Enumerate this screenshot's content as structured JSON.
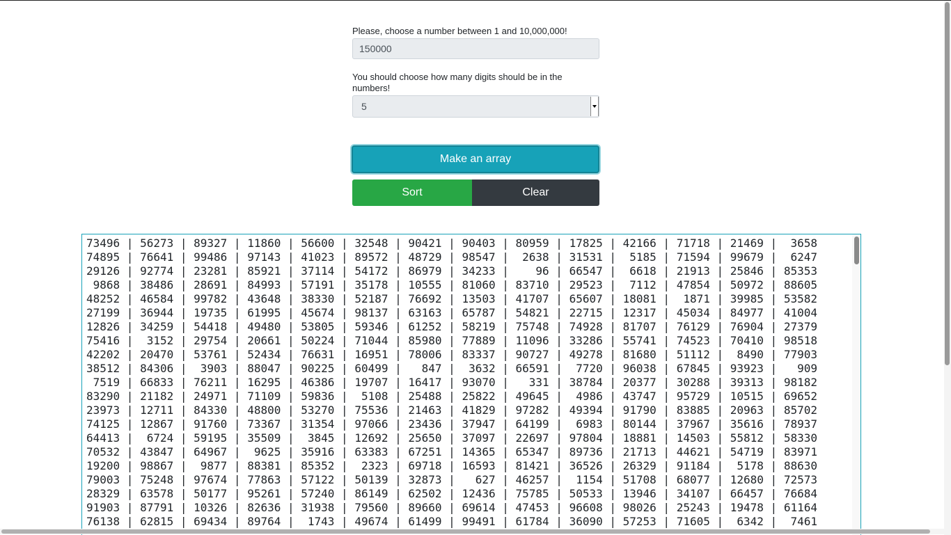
{
  "form": {
    "number_label": "Please, choose a number between 1 and 10,000,000!",
    "number_value": "150000",
    "digits_label": "You should choose how many digits should be in the numbers!",
    "digits_value": "5"
  },
  "buttons": {
    "make": "Make an array",
    "sort": "Sort",
    "clear": "Clear"
  },
  "output": {
    "rows": [
      [
        "73496",
        "56273",
        "89327",
        "11860",
        "56600",
        "32548",
        "90421",
        "90403",
        "80959",
        "17825",
        "42166",
        "71718",
        "21469",
        "3658"
      ],
      [
        "74895",
        "76641",
        "99486",
        "97143",
        "41023",
        "89572",
        "48729",
        "98547",
        "2638",
        "31531",
        "5185",
        "71594",
        "99679",
        "6247"
      ],
      [
        "29126",
        "92774",
        "23281",
        "85921",
        "37114",
        "54172",
        "86979",
        "34233",
        "96",
        "66547",
        "6618",
        "21913",
        "25846",
        "85353"
      ],
      [
        "9868",
        "38486",
        "28691",
        "84993",
        "57191",
        "35178",
        "10555",
        "81060",
        "83710",
        "29523",
        "7112",
        "47854",
        "50972",
        "88605"
      ],
      [
        "48252",
        "46584",
        "99782",
        "43648",
        "38330",
        "52187",
        "76692",
        "13503",
        "41707",
        "65607",
        "18081",
        "1871",
        "39985",
        "53582"
      ],
      [
        "27199",
        "36944",
        "19735",
        "61995",
        "45674",
        "98137",
        "63163",
        "65787",
        "54821",
        "22715",
        "12317",
        "45034",
        "84977",
        "41004"
      ],
      [
        "12826",
        "34259",
        "54418",
        "49480",
        "53805",
        "59346",
        "61252",
        "58219",
        "75748",
        "74928",
        "81707",
        "76129",
        "76904",
        "27379"
      ],
      [
        "75416",
        "3152",
        "29754",
        "20661",
        "50224",
        "71044",
        "85980",
        "77889",
        "11096",
        "33286",
        "55741",
        "74523",
        "70410",
        "98518"
      ],
      [
        "42202",
        "20470",
        "53761",
        "52434",
        "76631",
        "16951",
        "78006",
        "83337",
        "90727",
        "49278",
        "81680",
        "51112",
        "8490",
        "77903"
      ],
      [
        "38512",
        "84306",
        "3903",
        "88047",
        "90225",
        "60499",
        "847",
        "3632",
        "66591",
        "7720",
        "96038",
        "67845",
        "93923",
        "909"
      ],
      [
        "7519",
        "66833",
        "76211",
        "16295",
        "46386",
        "19707",
        "16417",
        "93070",
        "331",
        "38784",
        "20377",
        "30288",
        "39313",
        "98182"
      ],
      [
        "83290",
        "21182",
        "24971",
        "71109",
        "59836",
        "5108",
        "25488",
        "25822",
        "49645",
        "4986",
        "43747",
        "95729",
        "10515",
        "69652"
      ],
      [
        "23973",
        "12711",
        "84330",
        "48800",
        "53270",
        "75536",
        "21463",
        "41829",
        "97282",
        "49394",
        "91790",
        "83885",
        "20963",
        "85702"
      ],
      [
        "74125",
        "12867",
        "91760",
        "73367",
        "31354",
        "97066",
        "23436",
        "37947",
        "64199",
        "6983",
        "80144",
        "37967",
        "35616",
        "78937"
      ],
      [
        "64413",
        "6724",
        "59195",
        "35509",
        "3845",
        "12692",
        "25650",
        "37097",
        "22697",
        "97804",
        "18881",
        "14503",
        "55812",
        "58330"
      ],
      [
        "70532",
        "43847",
        "64967",
        "9625",
        "35916",
        "63383",
        "67251",
        "14365",
        "65347",
        "89736",
        "21713",
        "44621",
        "54719",
        "83971"
      ],
      [
        "19200",
        "98867",
        "9877",
        "88381",
        "85352",
        "2323",
        "69718",
        "16593",
        "81421",
        "36526",
        "26329",
        "91184",
        "5178",
        "88630"
      ],
      [
        "79003",
        "75248",
        "97674",
        "77863",
        "57122",
        "50139",
        "32873",
        "627",
        "46257",
        "1154",
        "51708",
        "68077",
        "12680",
        "72573"
      ],
      [
        "28329",
        "63578",
        "50177",
        "95261",
        "57240",
        "86149",
        "62502",
        "12436",
        "75785",
        "50533",
        "13946",
        "34107",
        "66457",
        "76684"
      ],
      [
        "91903",
        "87791",
        "10326",
        "82636",
        "31938",
        "79560",
        "89660",
        "69614",
        "47453",
        "96608",
        "98026",
        "25243",
        "19478",
        "61164"
      ],
      [
        "76138",
        "62815",
        "69434",
        "89764",
        "1743",
        "49674",
        "61499",
        "99491",
        "61784",
        "36090",
        "57253",
        "71605",
        "6342",
        "7461"
      ]
    ]
  }
}
